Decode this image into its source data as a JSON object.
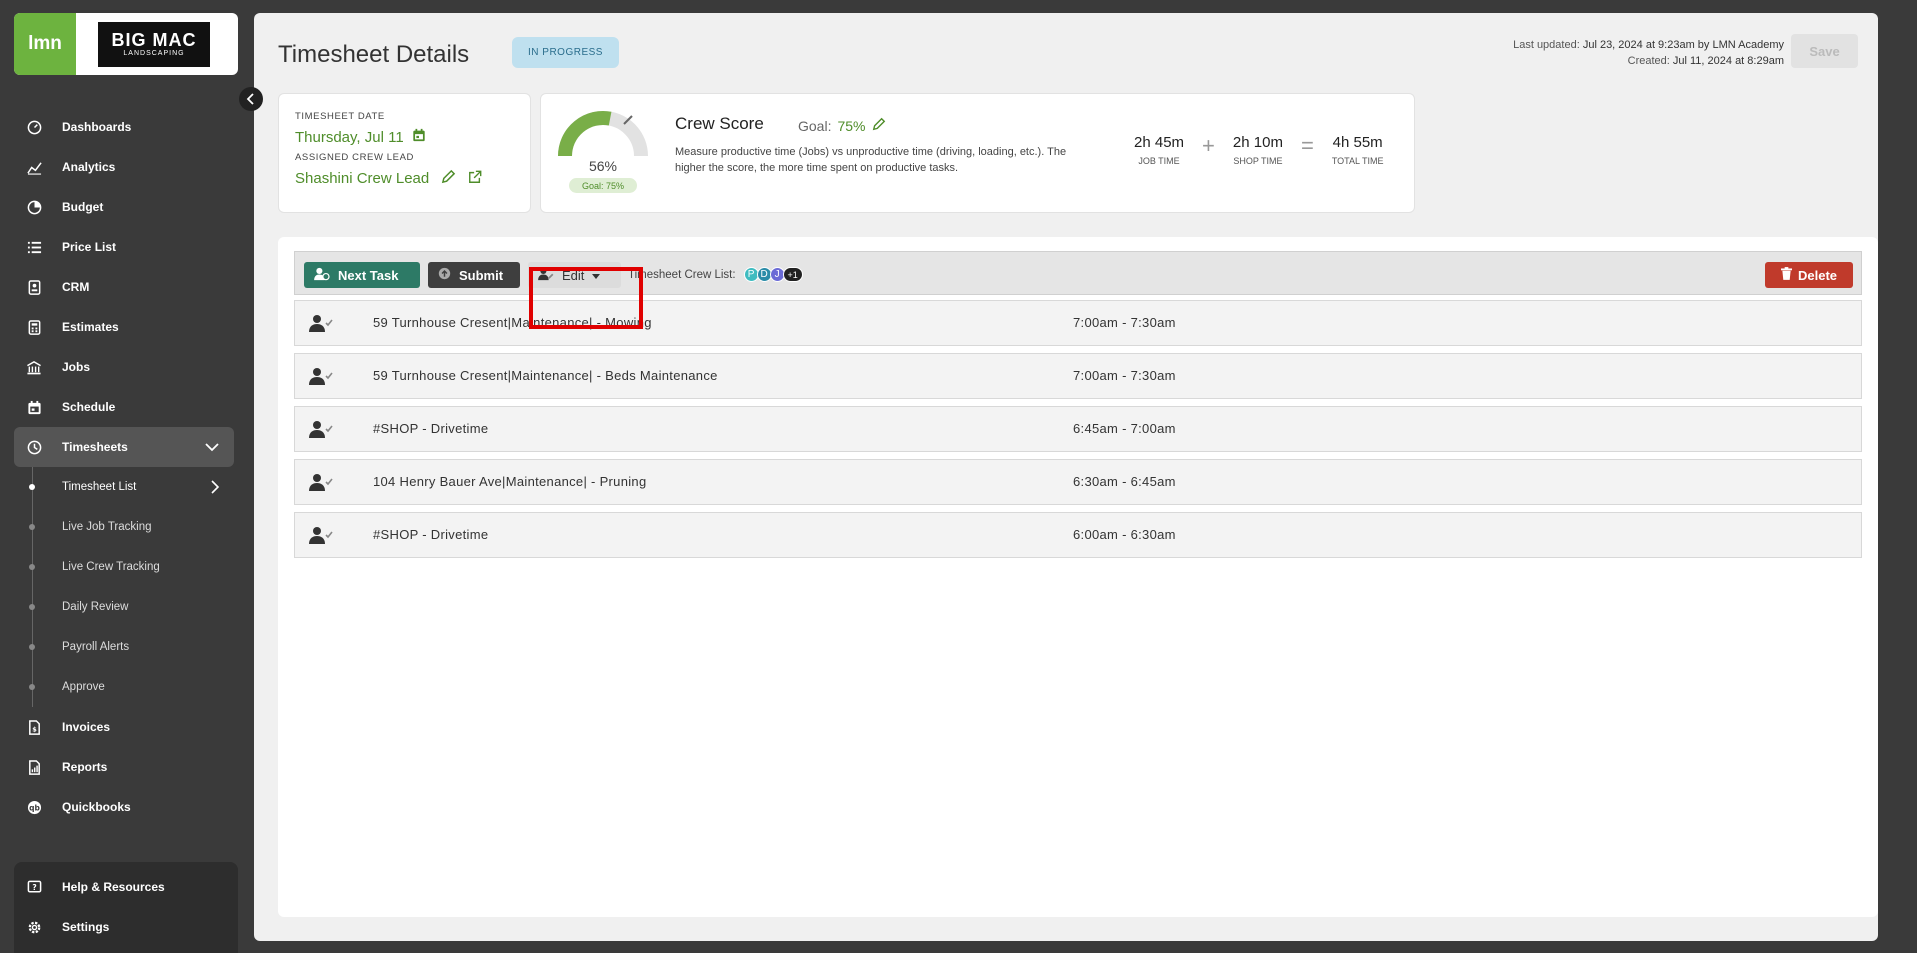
{
  "sidebar": {
    "logo_lmn": "lmn",
    "logo_company_big": "BIG MAC",
    "logo_company_small": "LANDSCAPING",
    "items": [
      {
        "label": "Dashboards",
        "icon": "gauge-icon"
      },
      {
        "label": "Analytics",
        "icon": "chart-line-icon"
      },
      {
        "label": "Budget",
        "icon": "pie-chart-icon"
      },
      {
        "label": "Price List",
        "icon": "list-icon"
      },
      {
        "label": "CRM",
        "icon": "contacts-icon"
      },
      {
        "label": "Estimates",
        "icon": "calculator-icon"
      },
      {
        "label": "Jobs",
        "icon": "building-icon"
      },
      {
        "label": "Schedule",
        "icon": "calendar-icon"
      },
      {
        "label": "Timesheets",
        "icon": "clock-icon"
      }
    ],
    "timesheet_subitems": [
      {
        "label": "Timesheet List"
      },
      {
        "label": "Live Job Tracking"
      },
      {
        "label": "Live Crew Tracking"
      },
      {
        "label": "Daily Review"
      },
      {
        "label": "Payroll Alerts"
      },
      {
        "label": "Approve"
      }
    ],
    "items_after": [
      {
        "label": "Invoices",
        "icon": "invoice-icon"
      },
      {
        "label": "Reports",
        "icon": "report-icon"
      },
      {
        "label": "Quickbooks",
        "icon": "quickbooks-icon"
      }
    ],
    "bottom": [
      {
        "label": "Help & Resources",
        "icon": "help-icon"
      },
      {
        "label": "Settings",
        "icon": "gear-icon"
      }
    ]
  },
  "header": {
    "title": "Timesheet Details",
    "status": "IN PROGRESS",
    "last_updated_label": "Last updated:",
    "last_updated_value": "Jul 23, 2024 at 9:23am by LMN Academy",
    "created_label": "Created:",
    "created_value": "Jul 11, 2024 at 8:29am",
    "save_label": "Save"
  },
  "date_card": {
    "date_label": "TIMESHEET DATE",
    "date_value": "Thursday, Jul 11",
    "lead_label": "ASSIGNED CREW LEAD",
    "lead_value": "Shashini Crew Lead"
  },
  "crew_score": {
    "gauge_value": "56%",
    "gauge_fraction": 0.56,
    "gauge_goal": "Goal: 75%",
    "title": "Crew Score",
    "goal_label": "Goal:",
    "goal_value": "75%",
    "description": "Measure productive time (Jobs) vs unproductive time (driving, loading, etc.). The higher the score, the more time spent on productive tasks.",
    "job_time_h": "2h",
    "job_time_m": "45m",
    "job_time_label": "JOB TIME",
    "shop_time_h": "2h",
    "shop_time_m": "10m",
    "shop_time_label": "SHOP TIME",
    "total_time_h": "4h",
    "total_time_m": "55m",
    "total_time_label": "TOTAL TIME",
    "plus": "+",
    "equals": "="
  },
  "toolbar": {
    "next_task_label": "Next Task",
    "submit_label": "Submit",
    "edit_label": "Edit",
    "crew_list_label": "Timesheet Crew List:",
    "avatars": [
      {
        "initial": "P",
        "color": "#3fbcc0"
      },
      {
        "initial": "D",
        "color": "#2b8ca8"
      },
      {
        "initial": "J",
        "color": "#6b6bd6"
      },
      {
        "initial": "+1",
        "color": "#222222"
      }
    ],
    "delete_label": "Delete"
  },
  "tasks": [
    {
      "name": "59 Turnhouse Cresent|Maintenance| - Mowing",
      "time": "7:00am - 7:30am"
    },
    {
      "name": "59 Turnhouse Cresent|Maintenance| - Beds Maintenance",
      "time": "7:00am - 7:30am"
    },
    {
      "name": "#SHOP - Drivetime",
      "time": "6:45am - 7:00am"
    },
    {
      "name": "104 Henry Bauer Ave|Maintenance| - Pruning",
      "time": "6:30am - 6:45am"
    },
    {
      "name": "#SHOP - Drivetime",
      "time": "6:00am - 6:30am"
    }
  ],
  "colors": {
    "brand_green": "#6db33f",
    "accent_green": "#4f8d2a",
    "next_task": "#2d7a66",
    "delete": "#c03a2b",
    "highlight": "#e00000"
  }
}
